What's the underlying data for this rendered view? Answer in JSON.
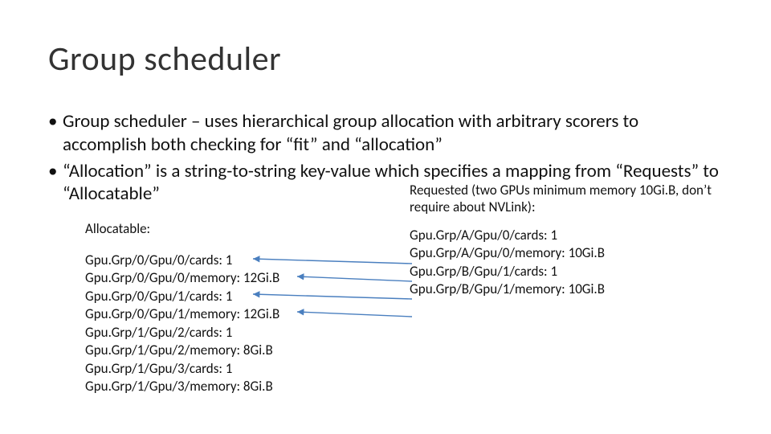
{
  "title": "Group scheduler",
  "bullets": [
    "Group scheduler – uses hierarchical group allocation with arbitrary scorers to accomplish both checking for “fit” and “allocation”",
    "“Allocation” is a string-to-string key-value which specifies a mapping from “Requests” to “Allocatable”"
  ],
  "left": {
    "heading": "Allocatable:",
    "lines": [
      "Gpu.Grp/0/Gpu/0/cards: 1",
      "Gpu.Grp/0/Gpu/0/memory: 12Gi.B",
      "Gpu.Grp/0/Gpu/1/cards: 1",
      "Gpu.Grp/0/Gpu/1/memory: 12Gi.B",
      "Gpu.Grp/1/Gpu/2/cards: 1",
      "Gpu.Grp/1/Gpu/2/memory: 8Gi.B",
      "Gpu.Grp/1/Gpu/3/cards: 1",
      "Gpu.Grp/1/Gpu/3/memory: 8Gi.B"
    ]
  },
  "right": {
    "heading": "Requested (two GPUs minimum memory 10Gi.B, don’t require about NVLink):",
    "lines": [
      "Gpu.Grp/A/Gpu/0/cards: 1",
      "Gpu.Grp/A/Gpu/0/memory: 10Gi.B",
      "Gpu.Grp/B/Gpu/1/cards: 1",
      "Gpu.Grp/B/Gpu/1/memory: 10Gi.B"
    ]
  }
}
